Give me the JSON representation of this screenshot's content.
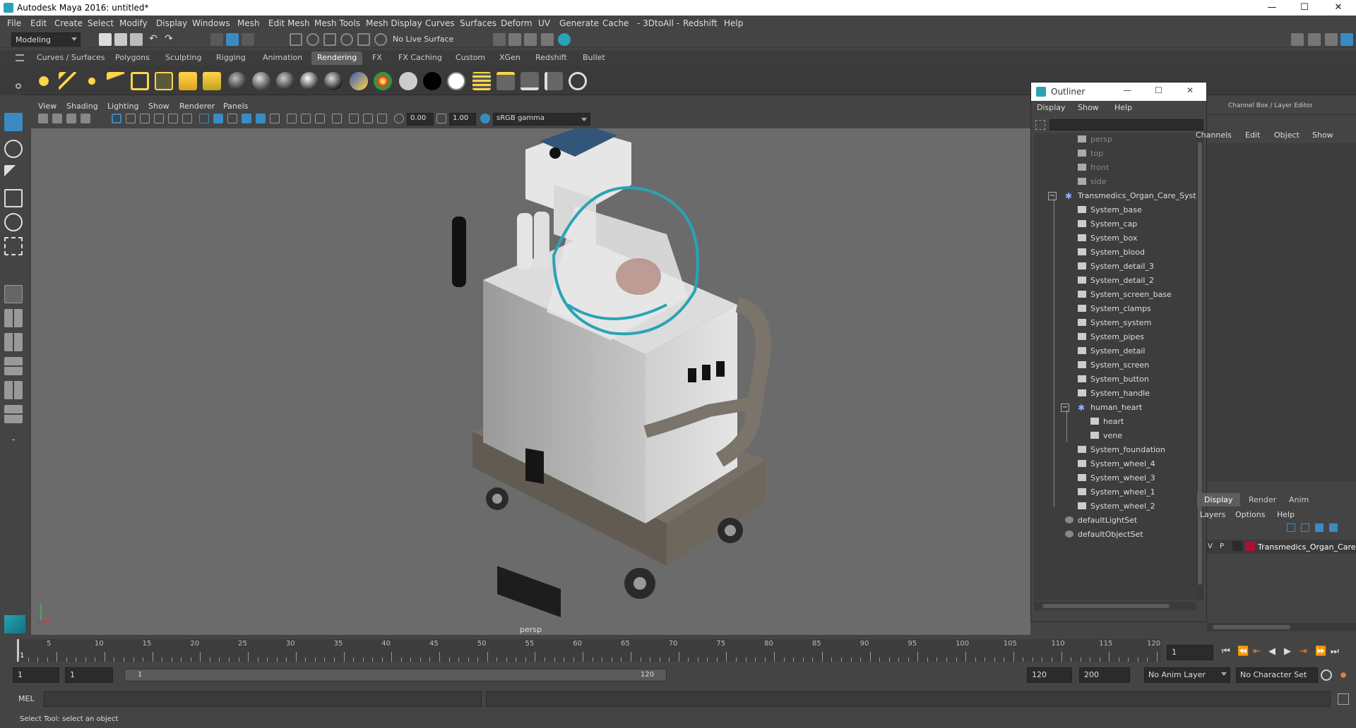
{
  "window": {
    "title": "Autodesk Maya 2016: untitled*",
    "min_glyph": "—",
    "max_glyph": "☐",
    "close_glyph": "✕"
  },
  "menubar": [
    "File",
    "Edit",
    "Create",
    "Select",
    "Modify",
    "Display",
    "Windows",
    "Mesh",
    "Edit Mesh",
    "Mesh Tools",
    "Mesh Display",
    "Curves",
    "Surfaces",
    "Deform",
    "UV",
    "Generate",
    "Cache",
    "- 3DtoAll -",
    "Redshift",
    "Help"
  ],
  "statusline": {
    "mode": "Modeling",
    "live_surface": "No Live Surface"
  },
  "shelf": {
    "tabs": [
      "Curves / Surfaces",
      "Polygons",
      "Sculpting",
      "Rigging",
      "Animation",
      "Rendering",
      "FX",
      "FX Caching",
      "Custom",
      "XGen",
      "Redshift",
      "Bullet"
    ],
    "active_tab": "Rendering"
  },
  "viewport": {
    "menu": [
      "View",
      "Shading",
      "Lighting",
      "Show",
      "Renderer",
      "Panels"
    ],
    "exposure": "0.00",
    "gamma": "1.00",
    "color_space": "sRGB gamma",
    "camera_label": "persp"
  },
  "outliner": {
    "title": "Outliner",
    "menu": [
      "Display",
      "Show",
      "Help"
    ],
    "items": [
      {
        "label": "persp",
        "dim": true,
        "type": "camera"
      },
      {
        "label": "top",
        "dim": true,
        "type": "camera"
      },
      {
        "label": "front",
        "dim": true,
        "type": "camera"
      },
      {
        "label": "side",
        "dim": true,
        "type": "camera"
      },
      {
        "label": "Transmedics_Organ_Care_System",
        "type": "group",
        "expanded": true
      },
      {
        "label": "System_base",
        "type": "mesh"
      },
      {
        "label": "System_cap",
        "type": "mesh"
      },
      {
        "label": "System_box",
        "type": "mesh"
      },
      {
        "label": "System_blood",
        "type": "mesh"
      },
      {
        "label": "System_detail_3",
        "type": "mesh"
      },
      {
        "label": "System_detail_2",
        "type": "mesh"
      },
      {
        "label": "System_screen_base",
        "type": "mesh"
      },
      {
        "label": "System_clamps",
        "type": "mesh"
      },
      {
        "label": "System_system",
        "type": "mesh"
      },
      {
        "label": "System_pipes",
        "type": "mesh"
      },
      {
        "label": "System_detail",
        "type": "mesh"
      },
      {
        "label": "System_screen",
        "type": "mesh"
      },
      {
        "label": "System_button",
        "type": "mesh"
      },
      {
        "label": "System_handle",
        "type": "mesh"
      },
      {
        "label": "human_heart",
        "type": "group",
        "expanded": true
      },
      {
        "label": "heart",
        "type": "mesh"
      },
      {
        "label": "vene",
        "type": "mesh"
      },
      {
        "label": "System_foundation",
        "type": "mesh"
      },
      {
        "label": "System_wheel_4",
        "type": "mesh"
      },
      {
        "label": "System_wheel_3",
        "type": "mesh"
      },
      {
        "label": "System_wheel_1",
        "type": "mesh"
      },
      {
        "label": "System_wheel_2",
        "type": "mesh"
      },
      {
        "label": "defaultLightSet",
        "type": "set"
      },
      {
        "label": "defaultObjectSet",
        "type": "set"
      }
    ]
  },
  "channelbox": {
    "title": "Channel Box / Layer Editor",
    "menu": [
      "Channels",
      "Edit",
      "Object",
      "Show"
    ],
    "layer_tabs": [
      "Display",
      "Render",
      "Anim"
    ],
    "layer_menu": [
      "Layers",
      "Options",
      "Help"
    ],
    "layer_row": {
      "v": "V",
      "p": "P",
      "name": "Transmedics_Organ_Care",
      "color": "#b01030"
    }
  },
  "timeline": {
    "ticks": [
      "5",
      "10",
      "15",
      "20",
      "25",
      "30",
      "35",
      "40",
      "45",
      "50",
      "55",
      "60",
      "65",
      "70",
      "75",
      "80",
      "85",
      "90",
      "95",
      "100",
      "105",
      "110",
      "115",
      "120"
    ],
    "start_label": "1",
    "current_frame": "1"
  },
  "range": {
    "start": "1",
    "playback_start": "1",
    "range_inner_start": "1",
    "range_inner_end": "120",
    "playback_end": "120",
    "end": "200",
    "anim_layer": "No Anim Layer",
    "character_set": "No Character Set"
  },
  "cmdline": {
    "label": "MEL"
  },
  "helpline": {
    "text": "Select Tool: select an object"
  },
  "colors": {
    "accent": "#3a8bc4",
    "teal_pipe": "#2aa3b4"
  }
}
